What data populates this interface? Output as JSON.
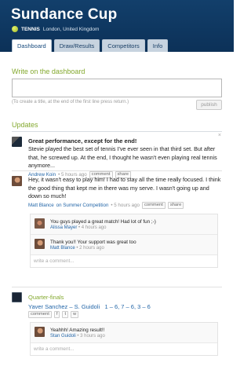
{
  "header": {
    "title": "Sundance Cup",
    "sport": "TENNIS",
    "location": "London, United Kingdom",
    "tabs": [
      {
        "label": "Dashboard",
        "active": true
      },
      {
        "label": "Draw/Results",
        "active": false
      },
      {
        "label": "Competitors",
        "active": false
      },
      {
        "label": "Info",
        "active": false
      }
    ]
  },
  "write": {
    "title": "Write on the dashboard",
    "hint": "(To create a title, at the end of the first line press return.)",
    "publish_label": "publish"
  },
  "updates": {
    "title": "Updates",
    "close_label": "×",
    "posts": [
      {
        "title": "Great performance, except for the end!",
        "text": "Stevie played the best set of tennis I've ever seen in that third set. But after that, he screwed up. At the end, I thought he wasn't even playing real tennis anymore...",
        "author": "Andrew Koin",
        "time": "• 5 hours ago",
        "actions": [
          "comment",
          "share"
        ]
      },
      {
        "text": "Hey, it wasn't easy to play him! I had to stay all the time really focused.  I think the good thing that kept me in there was my serve. I wasn't going up and down so much!",
        "author": "Matt Blance",
        "source": "on Summer Competition",
        "time": "• 5 hours ago",
        "actions": [
          "comment",
          "share"
        ],
        "comments": [
          {
            "text": "You guys played a great match! Had lot of fun ;-)",
            "author": "Alissa Mayer",
            "time": "• 4 hours ago"
          },
          {
            "text": "Thank you!! Your support was great too",
            "author": "Matt Blance",
            "time": "• 2 hours ago"
          }
        ],
        "write_comment": "write a comment..."
      },
      {
        "title": "Quarter-finals",
        "players": "Yaver Sanchez – S. Guidoli",
        "score": "1 – 6, 7 – 6, 3 – 6",
        "actions": [
          "comment",
          "f",
          "t",
          "w"
        ],
        "comments": [
          {
            "text": "Yeahhh! Amazing result!!",
            "author": "Stan Guidoli",
            "time": "• 3 hours ago"
          }
        ],
        "write_comment": "write a comment..."
      }
    ]
  }
}
